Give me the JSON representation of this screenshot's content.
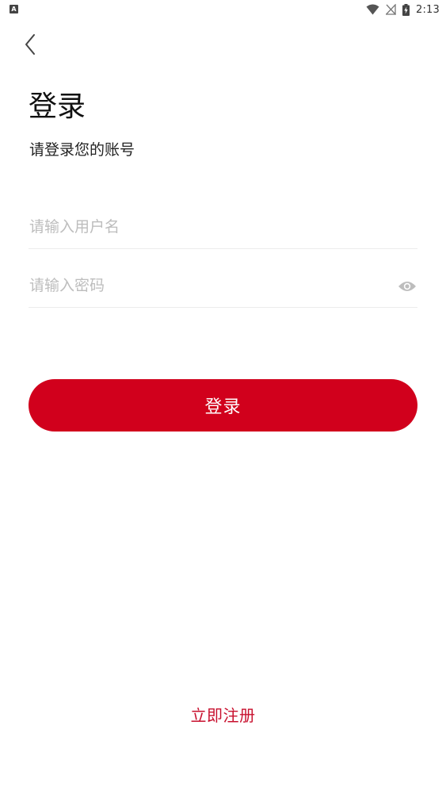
{
  "status_bar": {
    "time": "2:13",
    "notification_icon": "a-letter-icon",
    "wifi_icon": "wifi-icon",
    "signal_icon": "no-signal-icon",
    "battery_icon": "battery-charging-icon"
  },
  "nav": {
    "back_icon": "chevron-left-icon"
  },
  "header": {
    "title": "登录",
    "subtitle": "请登录您的账号"
  },
  "form": {
    "username": {
      "value": "",
      "placeholder": "请输入用户名"
    },
    "password": {
      "value": "",
      "placeholder": "请输入密码",
      "toggle_icon": "eye-icon"
    },
    "submit_label": "登录"
  },
  "footer": {
    "register_label": "立即注册"
  },
  "colors": {
    "brand_red": "#d1001c",
    "link_red": "#c8102e",
    "placeholder_gray": "#bdbdbd",
    "divider_gray": "#ececec"
  }
}
